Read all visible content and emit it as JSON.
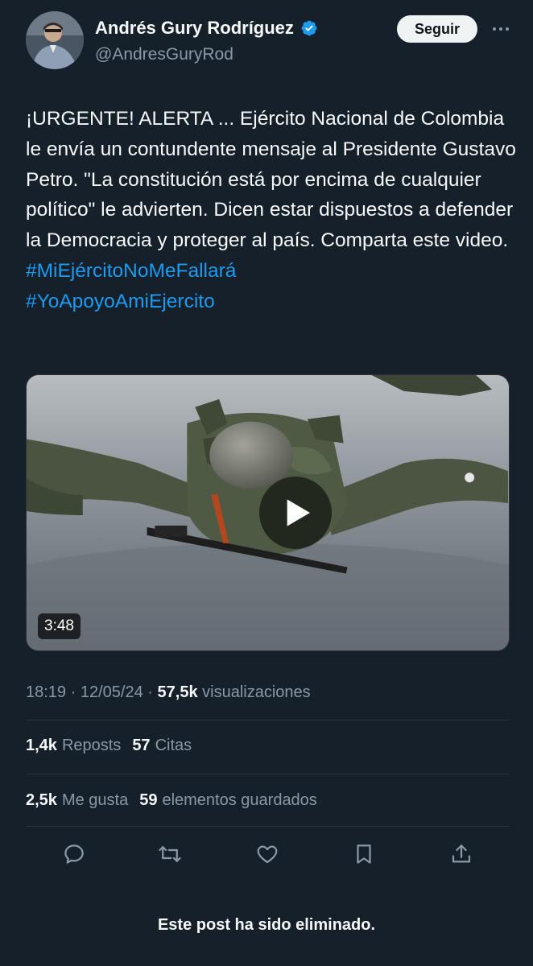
{
  "author": {
    "display_name": "Andrés Gury Rodríguez",
    "handle": "@AndresGuryRod",
    "verified": true
  },
  "follow_label": "Seguir",
  "tweet": {
    "text": "¡URGENTE! ALERTA ... Ejército Nacional de Colombia le envía un contundente mensaje al Presidente Gustavo Petro. \"La constitución está por encima de cualquier político\" le advierten. Dicen estar dispuestos a defender la Democracia y proteger al país. Comparta este video. ",
    "hashtags": [
      "#MiEjércitoNoMeFallará",
      "#YoApoyoAmiEjercito"
    ]
  },
  "media": {
    "duration": "3:48"
  },
  "meta": {
    "time": "18:19",
    "date": "12/05/24",
    "views_count": "57,5k",
    "views_label": "visualizaciones"
  },
  "stats": {
    "reposts_count": "1,4k",
    "reposts_label": "Reposts",
    "quotes_count": "57",
    "quotes_label": "Citas",
    "likes_count": "2,5k",
    "likes_label": "Me gusta",
    "bookmarks_count": "59",
    "bookmarks_label": "elementos guardados"
  },
  "footer_notice": "Este post ha sido eliminado.",
  "colors": {
    "background": "#15202b",
    "accent": "#1d9bf0",
    "muted": "#8b98a5"
  },
  "icons": [
    "verified-badge-icon",
    "more-icon",
    "play-icon",
    "reply-icon",
    "repost-icon",
    "like-icon",
    "bookmark-icon",
    "share-icon"
  ]
}
